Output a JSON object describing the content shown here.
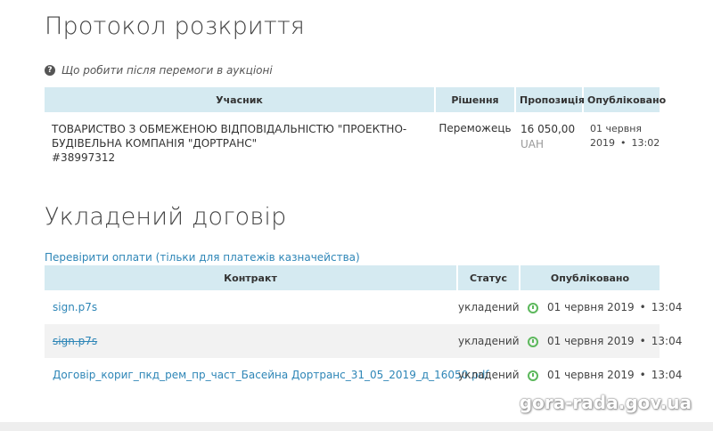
{
  "protocol": {
    "title": "Протокол розкриття",
    "help_icon": "question-circle-icon",
    "help_text": "Що робити після перемоги в аукціоні",
    "columns": [
      "Учасник",
      "Рішення",
      "Пропозиція",
      "Опубліковано"
    ],
    "rows": [
      {
        "participant_line1": "ТОВАРИСТВО З ОБМЕЖЕНОЮ ВІДПОВІДАЛЬНІСТЮ \"ПРОЕКТНО-",
        "participant_line2": "БУДІВЕЛЬНА КОМПАНІЯ \"ДОРТРАНС\"",
        "participant_id": "#38997312",
        "decision": "Переможець",
        "amount": "16 050,00",
        "currency": "UAH",
        "date": "01 червня",
        "year": "2019",
        "time": "13:02"
      }
    ]
  },
  "contract": {
    "title": "Укладений договір",
    "check_link": "Перевірити оплати (тільки для платежів казначейства)",
    "columns": [
      "Контракт",
      "Статус",
      "Опубліковано"
    ],
    "rows": [
      {
        "doc": "sign.p7s",
        "status": "укладений",
        "date": "01 червня 2019",
        "time": "13:04",
        "struck": false
      },
      {
        "doc": "sign.p7s",
        "status": "укладений",
        "date": "01 червня 2019",
        "time": "13:04",
        "struck": true
      },
      {
        "doc": "Договір_кориг_пкд_рем_пр_част_Басейна Дортранс_31_05_2019_д_16050.pdf",
        "status": "укладений",
        "date": "01 червня 2019",
        "time": "13:04",
        "struck": false
      }
    ]
  },
  "watermark": "gora-rada.gov.ua",
  "colors": {
    "header_bg": "#d5eaf1",
    "link": "#2e86b7",
    "status_icon": "#5cb85c",
    "row_shade": "#f2f2f2"
  }
}
